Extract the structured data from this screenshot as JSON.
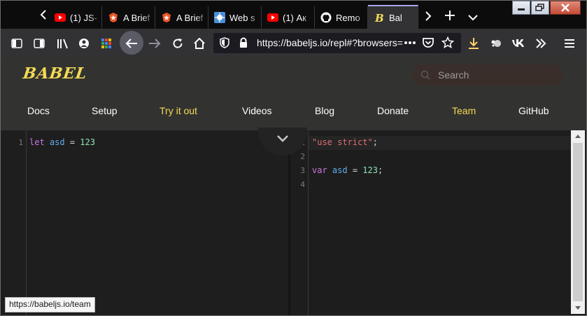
{
  "tabs": [
    {
      "label": "(1) JS-",
      "icon": "youtube-icon"
    },
    {
      "label": "A Brief",
      "icon": "auth0-icon"
    },
    {
      "label": "A Brief",
      "icon": "auth0-icon"
    },
    {
      "label": "Web s",
      "icon": "web-icon"
    },
    {
      "label": "(1) Ак",
      "icon": "youtube-icon"
    },
    {
      "label": "Remo",
      "icon": "github-icon"
    },
    {
      "label": "Bal",
      "icon": "babel-icon",
      "active": true
    }
  ],
  "address_bar": {
    "url": "https://babeljs.io/repl#?browsers="
  },
  "site": {
    "logo": "BABEL",
    "search_placeholder": "Search",
    "nav": [
      {
        "label": "Docs"
      },
      {
        "label": "Setup"
      },
      {
        "label": "Try it out",
        "highlight": true
      },
      {
        "label": "Videos"
      },
      {
        "label": "Blog"
      },
      {
        "label": "Donate"
      },
      {
        "label": "Team",
        "highlight": true
      },
      {
        "label": "GitHub"
      }
    ]
  },
  "editor_input": {
    "line_numbers": [
      "1"
    ],
    "lines": [
      [
        {
          "t": "let",
          "c": "kw"
        },
        {
          "t": " "
        },
        {
          "t": "asd",
          "c": "var"
        },
        {
          "t": " = ",
          "c": "op"
        },
        {
          "t": "123",
          "c": "num"
        }
      ]
    ]
  },
  "editor_output": {
    "line_numbers": [
      "1",
      "2",
      "3",
      "4"
    ],
    "lines": [
      [
        {
          "t": "\"use strict\"",
          "c": "str"
        },
        {
          "t": ";",
          "c": "punct"
        }
      ],
      [],
      [
        {
          "t": "var",
          "c": "kw"
        },
        {
          "t": " "
        },
        {
          "t": "asd",
          "c": "var"
        },
        {
          "t": " = ",
          "c": "op"
        },
        {
          "t": "123",
          "c": "num"
        },
        {
          "t": ";",
          "c": "punct"
        }
      ],
      []
    ]
  },
  "status_bar": {
    "link_preview": "https://babeljs.io/team"
  }
}
